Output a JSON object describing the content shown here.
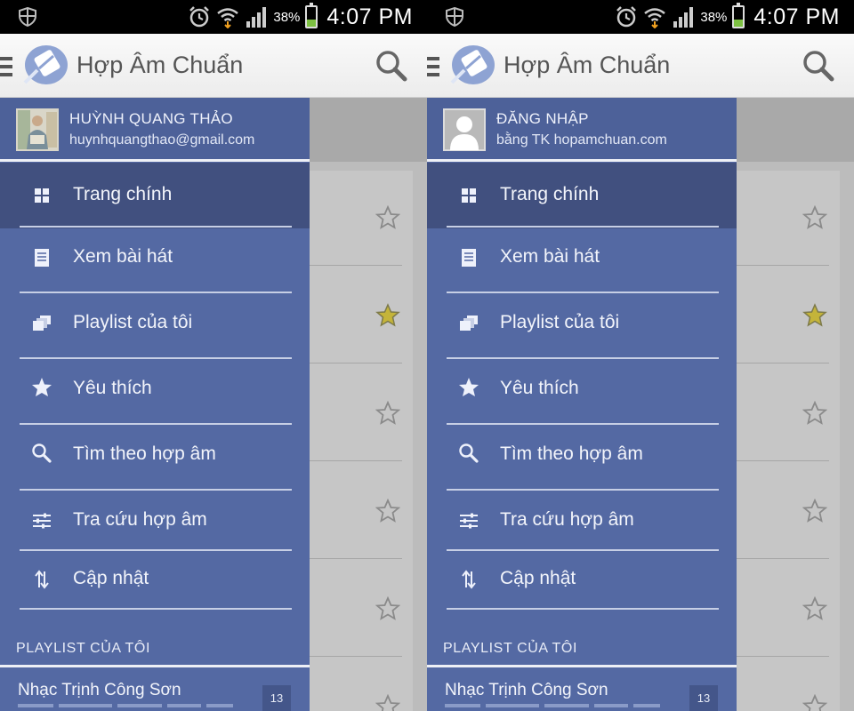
{
  "status_bar": {
    "battery_percent": "38%",
    "battery_level": 0.38,
    "time": "4:07 PM",
    "icons": [
      "shield-icon",
      "alarm-icon",
      "wifi-icon",
      "signal-icon",
      "battery-icon"
    ]
  },
  "app": {
    "title": "Hợp Âm Chuẩn",
    "logo_icon": "hac-guitar-pick-logo",
    "search_icon": "search-icon"
  },
  "colors": {
    "drawer_bg": "#5469a3",
    "drawer_active": "#41507f",
    "favorite_star": "#c4b43a"
  },
  "left_screen": {
    "account": {
      "name": "HUỲNH QUANG THẢO",
      "subtitle": "huynhquangthao@gmail.com"
    },
    "background_stars_filled": [
      false,
      true,
      false,
      false,
      false,
      false
    ]
  },
  "right_screen": {
    "account": {
      "name": "ĐĂNG NHẬP",
      "subtitle": "bằng TK hopamchuan.com"
    },
    "background_stars_filled": [
      false,
      true,
      false,
      false,
      false,
      false
    ]
  },
  "menu": {
    "items": [
      {
        "label": "Trang chính",
        "icon": "grid-icon",
        "active": true
      },
      {
        "label": "Xem bài hát",
        "icon": "document-icon",
        "active": false
      },
      {
        "label": "Playlist của tôi",
        "icon": "playlist-icon",
        "active": false
      },
      {
        "label": "Yêu thích",
        "icon": "star-icon",
        "active": false
      },
      {
        "label": "Tìm theo hợp âm",
        "icon": "search-icon",
        "active": false
      },
      {
        "label": "Tra cứu hợp âm",
        "icon": "sliders-icon",
        "active": false
      },
      {
        "label": "Cập nhật",
        "icon": "sync-arrows-icon",
        "active": false
      }
    ]
  },
  "playlist_section": {
    "title": "PLAYLIST CỦA TÔI",
    "items": [
      {
        "name": "Nhạc Trịnh Công Sơn",
        "count": "13"
      }
    ]
  }
}
